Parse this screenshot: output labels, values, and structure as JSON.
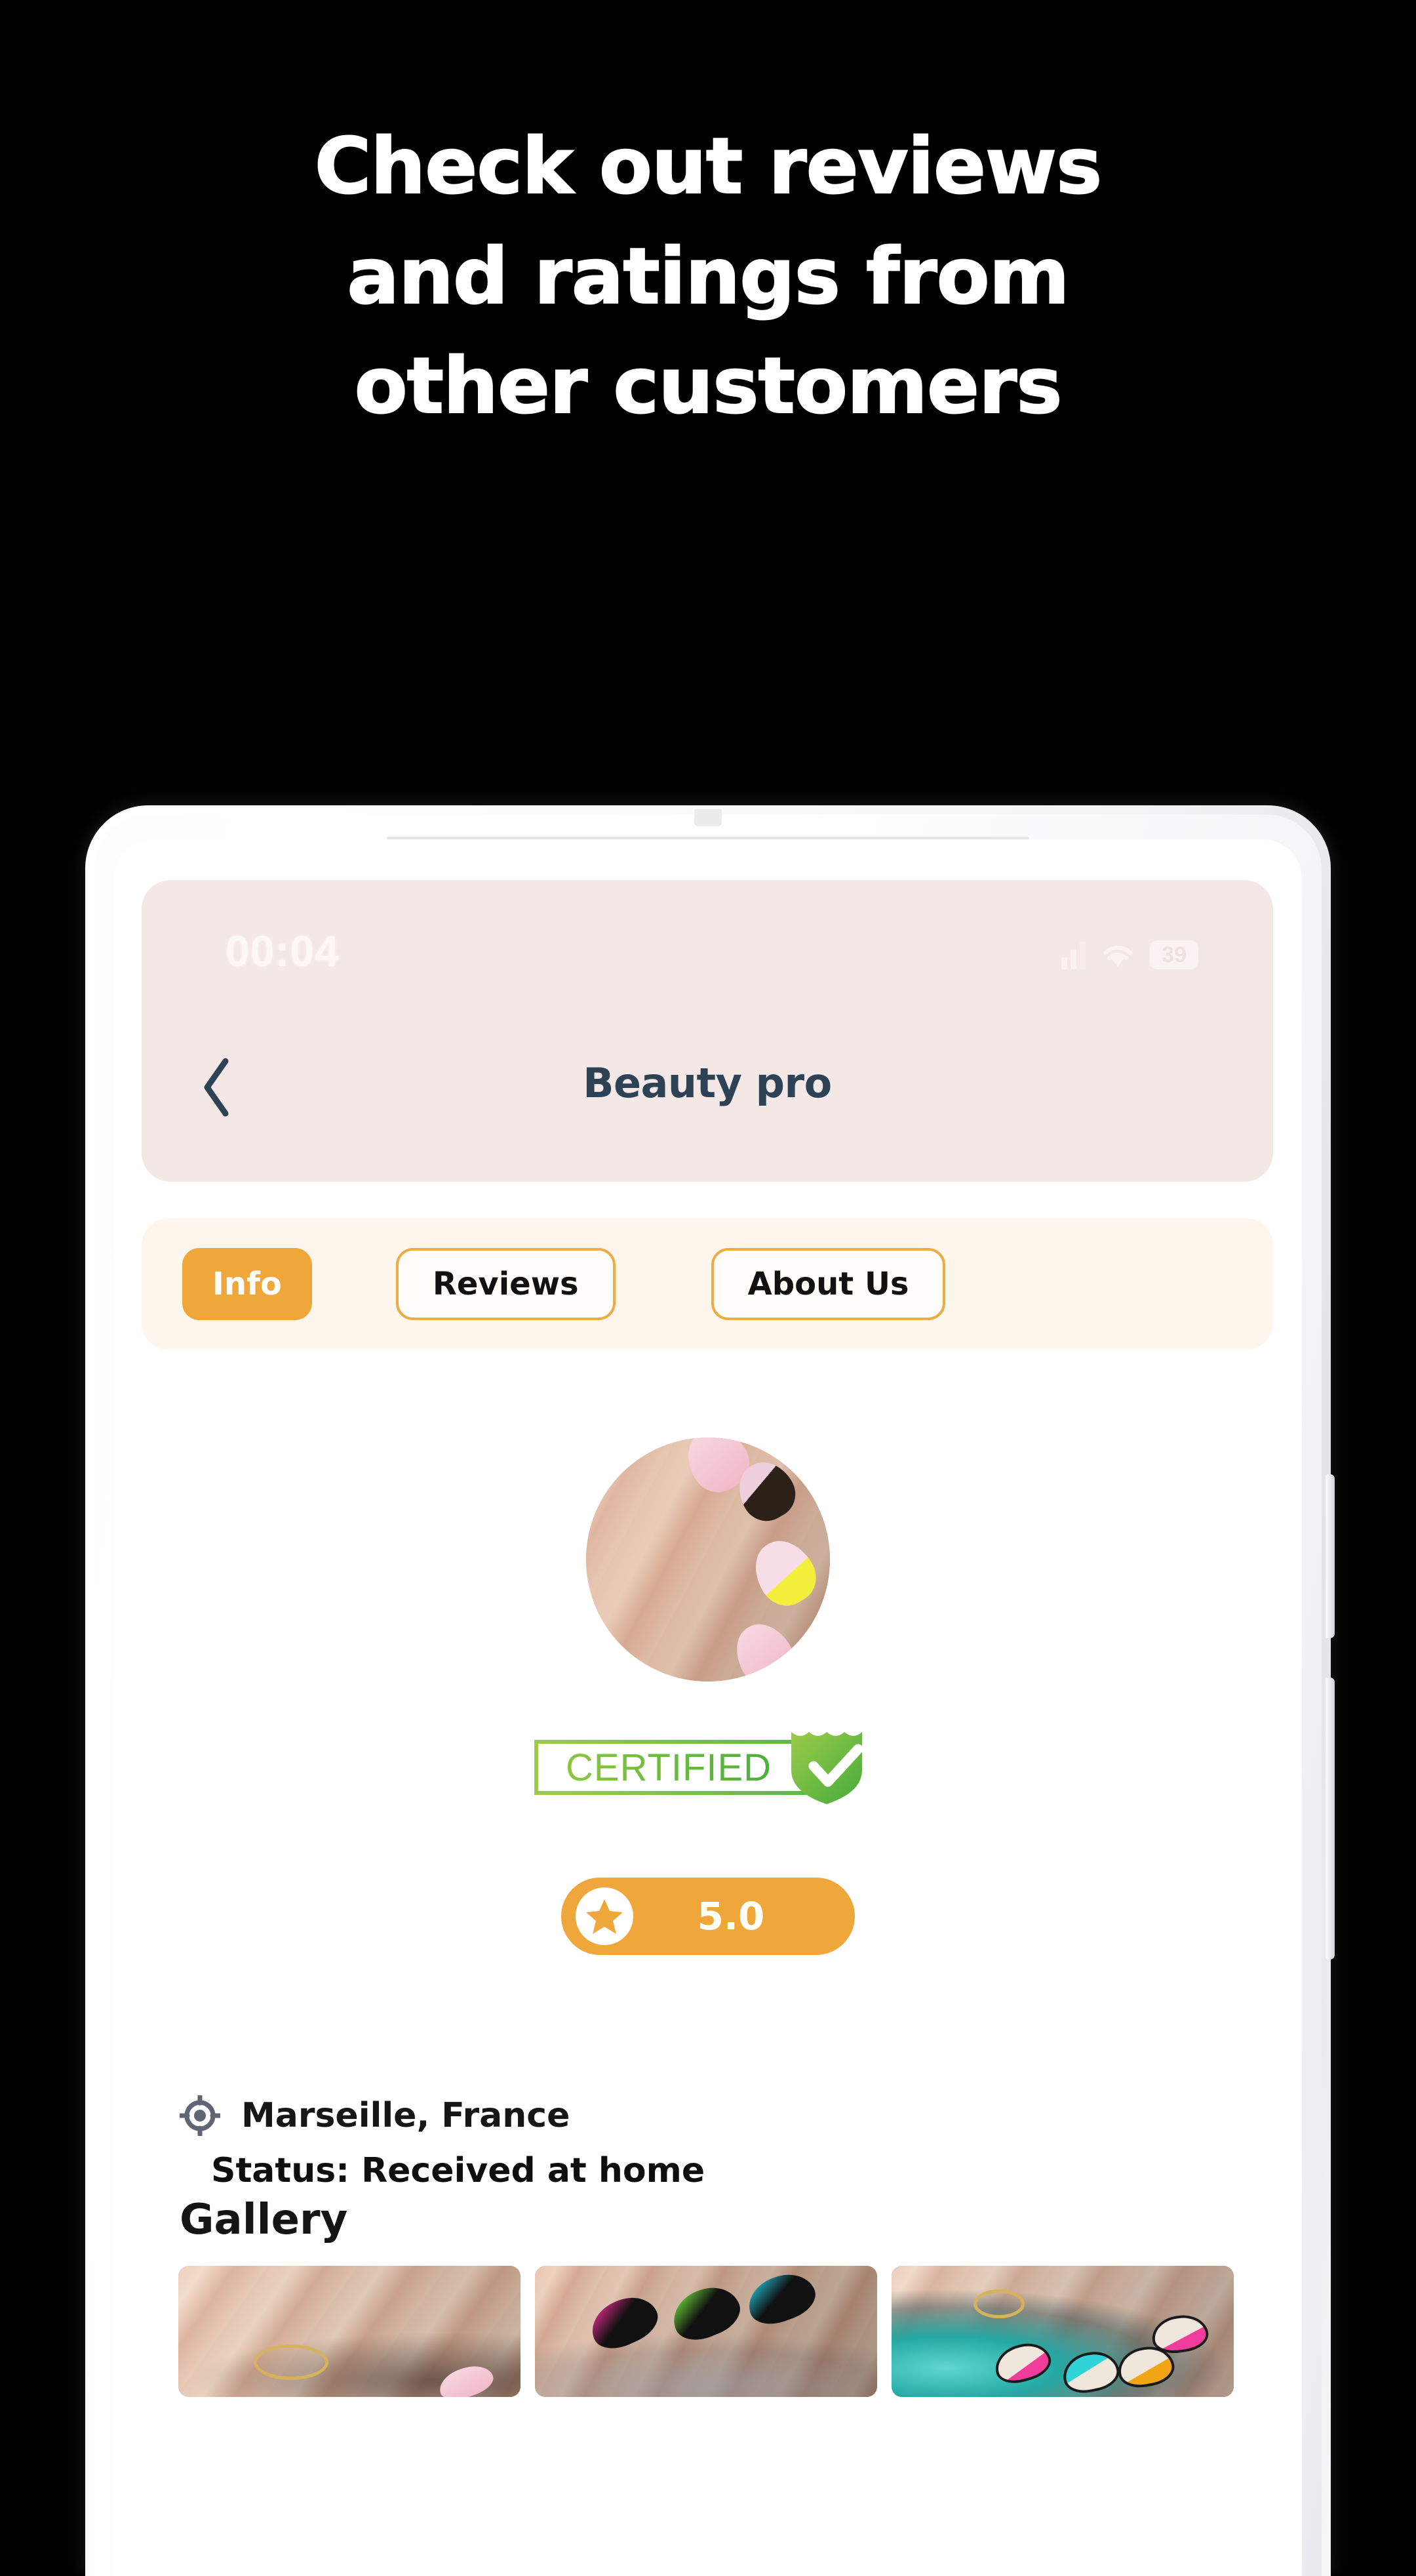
{
  "promo": {
    "headline_lines": [
      "Check out reviews",
      "and ratings from",
      "other customers"
    ],
    "background_color": "#000000",
    "text_color": "#ffffff"
  },
  "phone": {
    "frame_color": "#f4f4f6",
    "buttons": [
      "power-button",
      "volume-button"
    ],
    "earpiece": "earpiece-speaker"
  },
  "status_bar": {
    "time": "00:04",
    "battery_level": "39",
    "icons": [
      "signal-icon",
      "wifi-icon",
      "battery-icon"
    ]
  },
  "app_bar": {
    "title": "Beauty pro",
    "back_icon": "chevron-left-icon",
    "background_color": "#f4e8e6",
    "title_color": "#2e4256"
  },
  "tabs": [
    {
      "label": "Info",
      "active": true
    },
    {
      "label": "Reviews",
      "active": false
    },
    {
      "label": "About Us",
      "active": false
    }
  ],
  "tab_bar": {
    "background_color": "#fdf6ec",
    "active_color": "#efa73c",
    "border_color": "#eeab46"
  },
  "profile": {
    "avatar": "nail-art-avatar-photo",
    "certified_label": "CERTIFIED",
    "certified_icon": "shield-check-icon",
    "certified_color": "#57b947",
    "rating_value": "5.0",
    "rating_icon": "star-icon",
    "rating_color": "#efa73c",
    "location_icon": "gps-crosshair-icon",
    "location": "Marseille, France",
    "status": "Status: Received at home"
  },
  "gallery": {
    "title": "Gallery",
    "items": [
      {
        "name": "gallery-photo-1",
        "alt": "hand-with-gold-ring-pink-nails"
      },
      {
        "name": "gallery-photo-2",
        "alt": "neon-black-swirl-nails-on-glitter"
      },
      {
        "name": "gallery-photo-3",
        "alt": "pop-art-nails-on-teal-glitter"
      }
    ]
  }
}
